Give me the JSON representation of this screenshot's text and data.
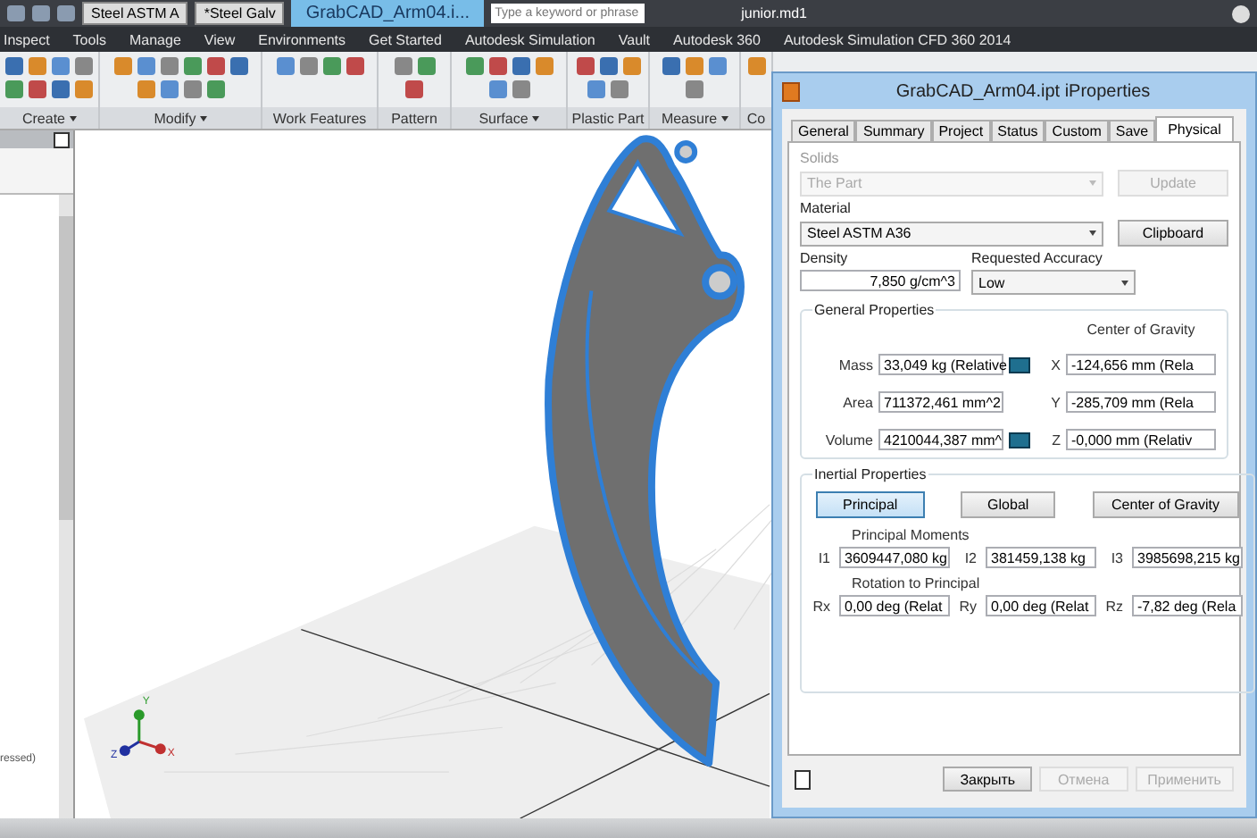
{
  "title_bar": {
    "material_combos": [
      "Steel ASTM A",
      "*Steel Galv"
    ],
    "document_tabs": [
      {
        "label": "GrabCAD_Arm04.i...",
        "selected": true
      }
    ],
    "search": {
      "placeholder": "Type a keyword or phrase"
    },
    "user": "junior.md1"
  },
  "menu": [
    "Inspect",
    "Tools",
    "Manage",
    "View",
    "Environments",
    "Get Started",
    "Autodesk Simulation",
    "Vault",
    "Autodesk 360",
    "Autodesk Simulation CFD 360 2014"
  ],
  "ribbon_panels": [
    {
      "label": "Create",
      "dropdown": true
    },
    {
      "label": "Modify",
      "dropdown": true
    },
    {
      "label": "Work Features",
      "dropdown": false
    },
    {
      "label": "Pattern",
      "dropdown": false
    },
    {
      "label": "Surface",
      "dropdown": true
    },
    {
      "label": "Plastic Part",
      "dropdown": false
    },
    {
      "label": "Measure",
      "dropdown": true
    },
    {
      "label": "Co",
      "dropdown": false
    }
  ],
  "browser": {
    "item": "ressed)"
  },
  "viewport": {
    "axes": [
      "X",
      "Y",
      "Z"
    ]
  },
  "dialog": {
    "title": "GrabCAD_Arm04.ipt iProperties",
    "tabs": [
      {
        "label": "General",
        "selected": false
      },
      {
        "label": "Summary",
        "selected": false
      },
      {
        "label": "Project",
        "selected": false
      },
      {
        "label": "Status",
        "selected": false
      },
      {
        "label": "Custom",
        "selected": false
      },
      {
        "label": "Save",
        "selected": false
      },
      {
        "label": "Physical",
        "selected": true
      }
    ],
    "solids": {
      "label": "Solids",
      "value": "The Part",
      "disabled": true
    },
    "update_button": {
      "label": "Update",
      "disabled": true
    },
    "material": {
      "label": "Material",
      "value": "Steel ASTM A36"
    },
    "clipboard_button": {
      "label": "Clipboard",
      "disabled": false
    },
    "density": {
      "label": "Density",
      "value": "7,850 g/cm^3"
    },
    "accuracy": {
      "label": "Requested Accuracy",
      "value": "Low"
    },
    "general": {
      "title": "General Properties",
      "cog_title": "Center of Gravity",
      "rows": [
        {
          "label": "Mass",
          "value": "33,049 kg (Relative",
          "icon": true,
          "axis": "X",
          "cog": "-124,656 mm (Rela"
        },
        {
          "label": "Area",
          "value": "711372,461 mm^2",
          "icon": false,
          "axis": "Y",
          "cog": "-285,709 mm (Rela"
        },
        {
          "label": "Volume",
          "value": "4210044,387 mm^",
          "icon": true,
          "axis": "Z",
          "cog": "-0,000 mm (Relativ"
        }
      ]
    },
    "inertial": {
      "title": "Inertial Properties",
      "modes": [
        {
          "label": "Principal",
          "selected": true
        },
        {
          "label": "Global",
          "selected": false
        },
        {
          "label": "Center of Gravity",
          "selected": false
        }
      ],
      "moments_title": "Principal Moments",
      "moments": [
        {
          "label": "I1",
          "value": "3609447,080 kg"
        },
        {
          "label": "I2",
          "value": "381459,138 kg"
        },
        {
          "label": "I3",
          "value": "3985698,215 kg"
        }
      ],
      "rotation_title": "Rotation to Principal",
      "rotations": [
        {
          "label": "Rx",
          "value": "0,00 deg (Relat"
        },
        {
          "label": "Ry",
          "value": "0,00 deg (Relat"
        },
        {
          "label": "Rz",
          "value": "-7,82 deg (Rela"
        }
      ]
    },
    "buttons": [
      {
        "label": "Закрыть",
        "disabled": false
      },
      {
        "label": "Отмена",
        "disabled": true
      },
      {
        "label": "Применить",
        "disabled": true
      }
    ]
  }
}
